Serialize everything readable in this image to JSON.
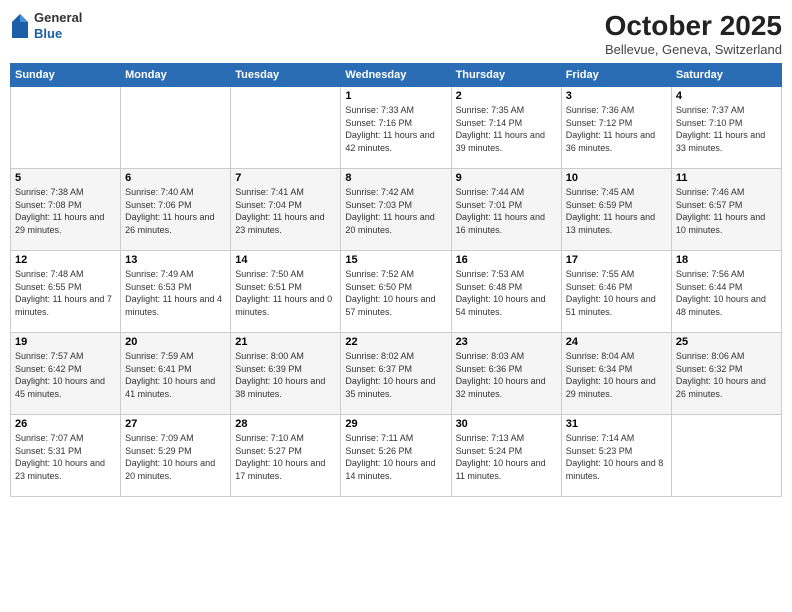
{
  "header": {
    "logo": {
      "general": "General",
      "blue": "Blue"
    },
    "title": "October 2025",
    "location": "Bellevue, Geneva, Switzerland"
  },
  "calendar": {
    "headers": [
      "Sunday",
      "Monday",
      "Tuesday",
      "Wednesday",
      "Thursday",
      "Friday",
      "Saturday"
    ],
    "weeks": [
      [
        {
          "day": "",
          "sunrise": "",
          "sunset": "",
          "daylight": ""
        },
        {
          "day": "",
          "sunrise": "",
          "sunset": "",
          "daylight": ""
        },
        {
          "day": "",
          "sunrise": "",
          "sunset": "",
          "daylight": ""
        },
        {
          "day": "1",
          "sunrise": "Sunrise: 7:33 AM",
          "sunset": "Sunset: 7:16 PM",
          "daylight": "Daylight: 11 hours and 42 minutes."
        },
        {
          "day": "2",
          "sunrise": "Sunrise: 7:35 AM",
          "sunset": "Sunset: 7:14 PM",
          "daylight": "Daylight: 11 hours and 39 minutes."
        },
        {
          "day": "3",
          "sunrise": "Sunrise: 7:36 AM",
          "sunset": "Sunset: 7:12 PM",
          "daylight": "Daylight: 11 hours and 36 minutes."
        },
        {
          "day": "4",
          "sunrise": "Sunrise: 7:37 AM",
          "sunset": "Sunset: 7:10 PM",
          "daylight": "Daylight: 11 hours and 33 minutes."
        }
      ],
      [
        {
          "day": "5",
          "sunrise": "Sunrise: 7:38 AM",
          "sunset": "Sunset: 7:08 PM",
          "daylight": "Daylight: 11 hours and 29 minutes."
        },
        {
          "day": "6",
          "sunrise": "Sunrise: 7:40 AM",
          "sunset": "Sunset: 7:06 PM",
          "daylight": "Daylight: 11 hours and 26 minutes."
        },
        {
          "day": "7",
          "sunrise": "Sunrise: 7:41 AM",
          "sunset": "Sunset: 7:04 PM",
          "daylight": "Daylight: 11 hours and 23 minutes."
        },
        {
          "day": "8",
          "sunrise": "Sunrise: 7:42 AM",
          "sunset": "Sunset: 7:03 PM",
          "daylight": "Daylight: 11 hours and 20 minutes."
        },
        {
          "day": "9",
          "sunrise": "Sunrise: 7:44 AM",
          "sunset": "Sunset: 7:01 PM",
          "daylight": "Daylight: 11 hours and 16 minutes."
        },
        {
          "day": "10",
          "sunrise": "Sunrise: 7:45 AM",
          "sunset": "Sunset: 6:59 PM",
          "daylight": "Daylight: 11 hours and 13 minutes."
        },
        {
          "day": "11",
          "sunrise": "Sunrise: 7:46 AM",
          "sunset": "Sunset: 6:57 PM",
          "daylight": "Daylight: 11 hours and 10 minutes."
        }
      ],
      [
        {
          "day": "12",
          "sunrise": "Sunrise: 7:48 AM",
          "sunset": "Sunset: 6:55 PM",
          "daylight": "Daylight: 11 hours and 7 minutes."
        },
        {
          "day": "13",
          "sunrise": "Sunrise: 7:49 AM",
          "sunset": "Sunset: 6:53 PM",
          "daylight": "Daylight: 11 hours and 4 minutes."
        },
        {
          "day": "14",
          "sunrise": "Sunrise: 7:50 AM",
          "sunset": "Sunset: 6:51 PM",
          "daylight": "Daylight: 11 hours and 0 minutes."
        },
        {
          "day": "15",
          "sunrise": "Sunrise: 7:52 AM",
          "sunset": "Sunset: 6:50 PM",
          "daylight": "Daylight: 10 hours and 57 minutes."
        },
        {
          "day": "16",
          "sunrise": "Sunrise: 7:53 AM",
          "sunset": "Sunset: 6:48 PM",
          "daylight": "Daylight: 10 hours and 54 minutes."
        },
        {
          "day": "17",
          "sunrise": "Sunrise: 7:55 AM",
          "sunset": "Sunset: 6:46 PM",
          "daylight": "Daylight: 10 hours and 51 minutes."
        },
        {
          "day": "18",
          "sunrise": "Sunrise: 7:56 AM",
          "sunset": "Sunset: 6:44 PM",
          "daylight": "Daylight: 10 hours and 48 minutes."
        }
      ],
      [
        {
          "day": "19",
          "sunrise": "Sunrise: 7:57 AM",
          "sunset": "Sunset: 6:42 PM",
          "daylight": "Daylight: 10 hours and 45 minutes."
        },
        {
          "day": "20",
          "sunrise": "Sunrise: 7:59 AM",
          "sunset": "Sunset: 6:41 PM",
          "daylight": "Daylight: 10 hours and 41 minutes."
        },
        {
          "day": "21",
          "sunrise": "Sunrise: 8:00 AM",
          "sunset": "Sunset: 6:39 PM",
          "daylight": "Daylight: 10 hours and 38 minutes."
        },
        {
          "day": "22",
          "sunrise": "Sunrise: 8:02 AM",
          "sunset": "Sunset: 6:37 PM",
          "daylight": "Daylight: 10 hours and 35 minutes."
        },
        {
          "day": "23",
          "sunrise": "Sunrise: 8:03 AM",
          "sunset": "Sunset: 6:36 PM",
          "daylight": "Daylight: 10 hours and 32 minutes."
        },
        {
          "day": "24",
          "sunrise": "Sunrise: 8:04 AM",
          "sunset": "Sunset: 6:34 PM",
          "daylight": "Daylight: 10 hours and 29 minutes."
        },
        {
          "day": "25",
          "sunrise": "Sunrise: 8:06 AM",
          "sunset": "Sunset: 6:32 PM",
          "daylight": "Daylight: 10 hours and 26 minutes."
        }
      ],
      [
        {
          "day": "26",
          "sunrise": "Sunrise: 7:07 AM",
          "sunset": "Sunset: 5:31 PM",
          "daylight": "Daylight: 10 hours and 23 minutes."
        },
        {
          "day": "27",
          "sunrise": "Sunrise: 7:09 AM",
          "sunset": "Sunset: 5:29 PM",
          "daylight": "Daylight: 10 hours and 20 minutes."
        },
        {
          "day": "28",
          "sunrise": "Sunrise: 7:10 AM",
          "sunset": "Sunset: 5:27 PM",
          "daylight": "Daylight: 10 hours and 17 minutes."
        },
        {
          "day": "29",
          "sunrise": "Sunrise: 7:11 AM",
          "sunset": "Sunset: 5:26 PM",
          "daylight": "Daylight: 10 hours and 14 minutes."
        },
        {
          "day": "30",
          "sunrise": "Sunrise: 7:13 AM",
          "sunset": "Sunset: 5:24 PM",
          "daylight": "Daylight: 10 hours and 11 minutes."
        },
        {
          "day": "31",
          "sunrise": "Sunrise: 7:14 AM",
          "sunset": "Sunset: 5:23 PM",
          "daylight": "Daylight: 10 hours and 8 minutes."
        },
        {
          "day": "",
          "sunrise": "",
          "sunset": "",
          "daylight": ""
        }
      ]
    ]
  }
}
